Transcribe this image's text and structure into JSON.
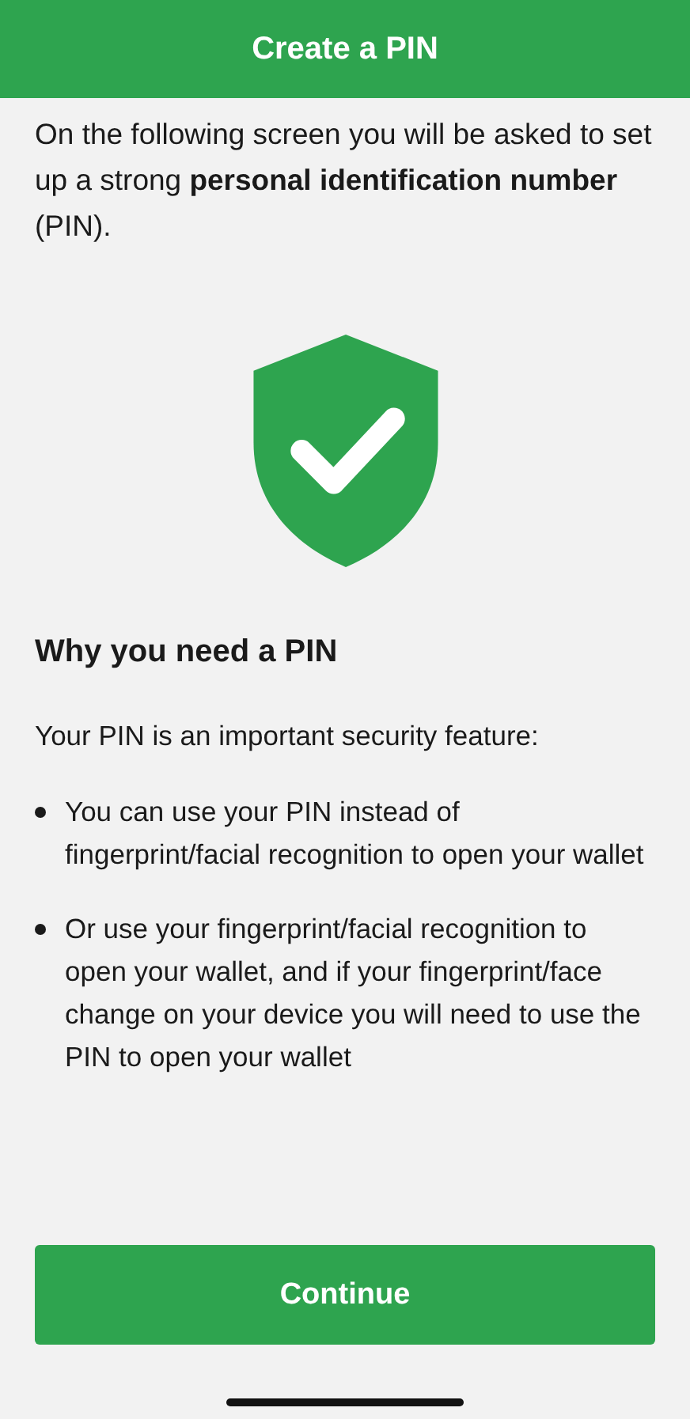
{
  "header": {
    "title": "Create a PIN"
  },
  "intro": "On the following screen you will be asked to set up a strong **personal identification number** (PIN).",
  "section": {
    "heading": "Why you need a PIN",
    "lead": "Your PIN is an important security feature:",
    "bullets": [
      "You can use your PIN instead of fingerprint/facial recognition to open your wallet",
      "Or use your fingerprint/facial recognition to open your wallet, and if your fingerprint/face change on your device you will need to use the PIN to open your wallet"
    ]
  },
  "button": {
    "label": "Continue"
  }
}
